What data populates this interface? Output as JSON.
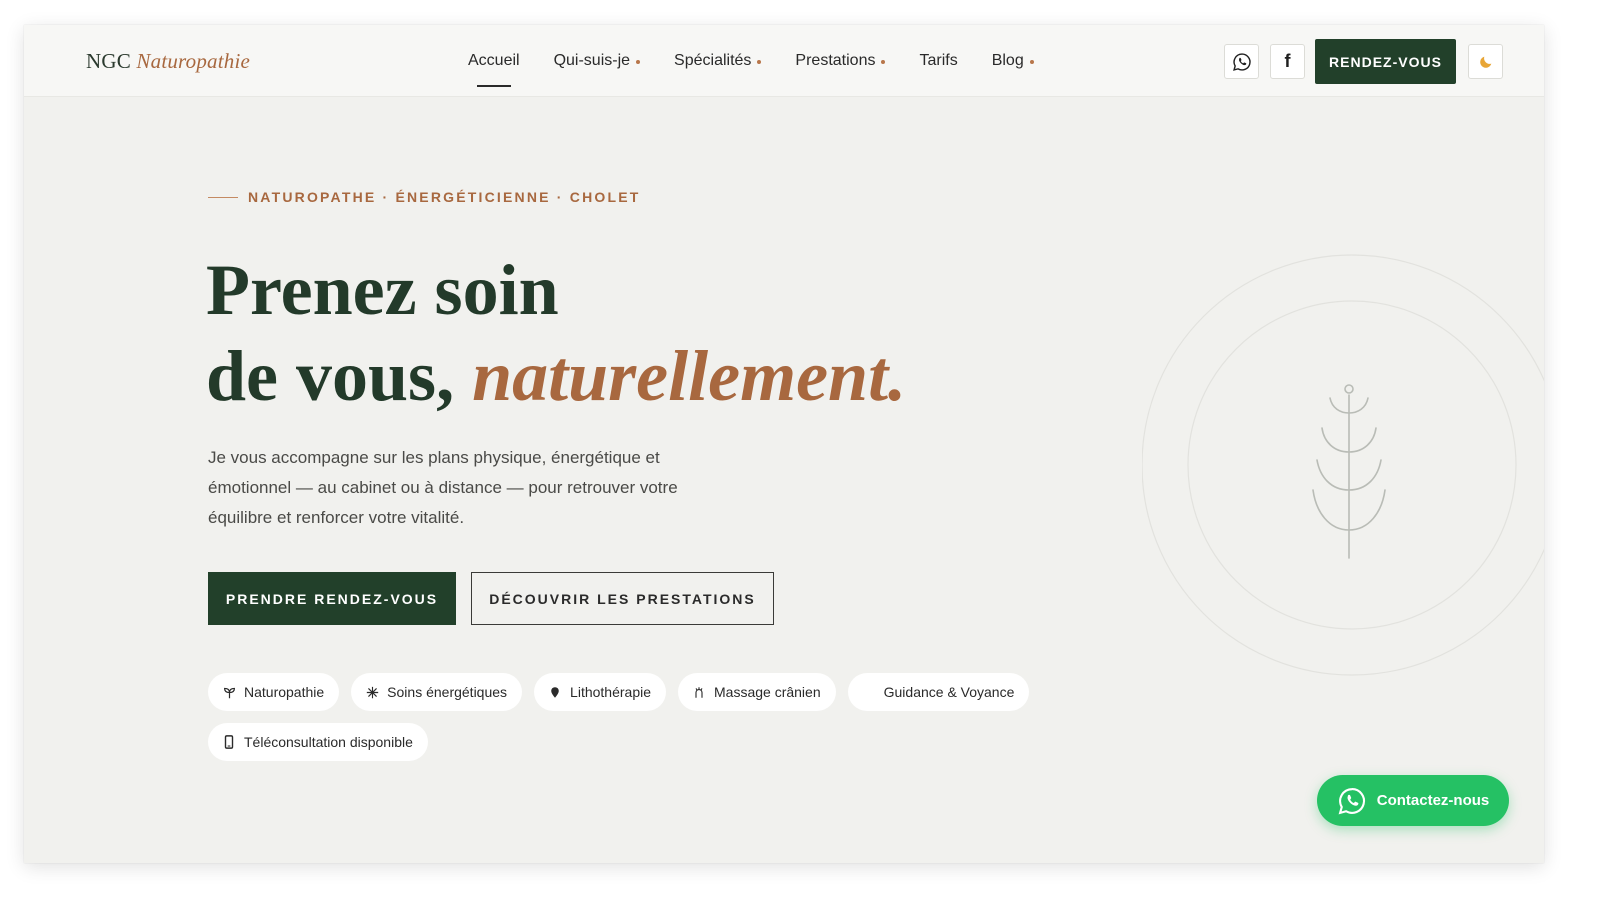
{
  "header": {
    "logo_main": "NGC",
    "logo_accent": "Naturopathie",
    "nav": [
      {
        "label": "Accueil",
        "active": true,
        "has_dropdown": false
      },
      {
        "label": "Qui-suis-je",
        "active": false,
        "has_dropdown": true
      },
      {
        "label": "Spécialités",
        "active": false,
        "has_dropdown": true
      },
      {
        "label": "Prestations",
        "active": false,
        "has_dropdown": true
      },
      {
        "label": "Tarifs",
        "active": false,
        "has_dropdown": false
      },
      {
        "label": "Blog",
        "active": false,
        "has_dropdown": true
      }
    ],
    "icons": [
      "whatsapp-icon",
      "facebook-icon",
      "moon-icon"
    ],
    "cta_label": "RENDEZ-VOUS"
  },
  "hero": {
    "eyebrow": "NATUROPATHE · ÉNERGÉTICIENNE · CHOLET",
    "headline_line1": "Prenez soin",
    "headline_line2_plain": "de vous, ",
    "headline_line2_accent": "naturellement.",
    "lead": "Je vous accompagne sur les plans physique, énergétique et émotionnel — au cabinet ou à distance — pour retrouver votre équilibre et renforcer votre vitalité.",
    "cta_primary": "PRENDRE RENDEZ-VOUS",
    "cta_secondary": "DÉCOUVRIR LES PRESTATIONS",
    "chips": [
      {
        "label": "Naturopathie",
        "icon": "sprout-icon"
      },
      {
        "label": "Soins énergétiques",
        "icon": "sparkle-icon"
      },
      {
        "label": "Lithothérapie",
        "icon": "gem-icon"
      },
      {
        "label": "Massage crânien",
        "icon": "head-icon"
      },
      {
        "label": "Guidance & Voyance",
        "icon": "moon-icon"
      },
      {
        "label": "Téléconsultation disponible",
        "icon": "phone-icon"
      }
    ]
  },
  "floating": {
    "whatsapp_label": "Contactez-nous",
    "icon": "whatsapp-icon"
  },
  "colors": {
    "forest": "#22402a",
    "copper": "#a8683f",
    "background": "#f1f1ee",
    "whatsapp": "#25c164"
  }
}
